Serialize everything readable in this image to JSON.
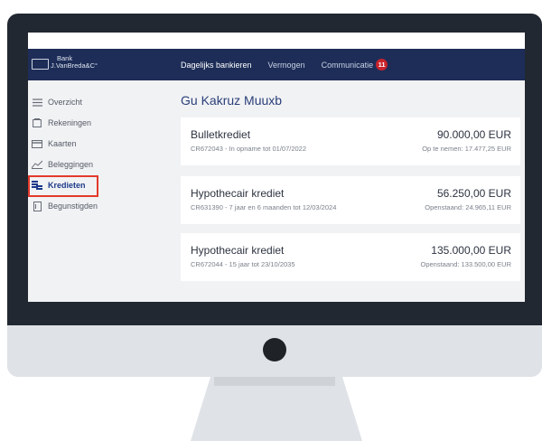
{
  "brand": {
    "line1": "Bank",
    "line2": "J.VanBreda&C°"
  },
  "nav": {
    "items": [
      {
        "label": "Dagelijks bankieren",
        "active": true
      },
      {
        "label": "Vermogen",
        "active": false
      },
      {
        "label": "Communicatie",
        "active": false,
        "badge": "11"
      }
    ]
  },
  "sidebar": {
    "items": [
      {
        "label": "Overzicht",
        "icon": "list-icon"
      },
      {
        "label": "Rekeningen",
        "icon": "document-icon"
      },
      {
        "label": "Kaarten",
        "icon": "card-icon"
      },
      {
        "label": "Beleggingen",
        "icon": "chart-icon"
      },
      {
        "label": "Kredieten",
        "icon": "coins-icon",
        "active": true
      },
      {
        "label": "Begunstigden",
        "icon": "contact-icon"
      }
    ]
  },
  "main": {
    "title": "Gu Kakruz Muuxb",
    "loans": [
      {
        "name": "Bulletkrediet",
        "detail": "CR672043 - In opname tot 01/07/2022",
        "amount": "90.000,00 EUR",
        "sub": "Op te nemen: 17.477,25 EUR"
      },
      {
        "name": "Hypothecair krediet",
        "detail": "CR631390 - 7 jaar en 6 maanden tot 12/03/2024",
        "amount": "56.250,00 EUR",
        "sub": "Openstaand: 24.965,11 EUR"
      },
      {
        "name": "Hypothecair krediet",
        "detail": "CR672044 - 15 jaar tot 23/10/2035",
        "amount": "135.000,00 EUR",
        "sub": "Openstaand: 133.500,00 EUR"
      }
    ]
  },
  "colors": {
    "navbar": "#1d2d58",
    "accent": "#2a3f79",
    "badge": "#c8232c",
    "highlight": "#e33a2c"
  }
}
